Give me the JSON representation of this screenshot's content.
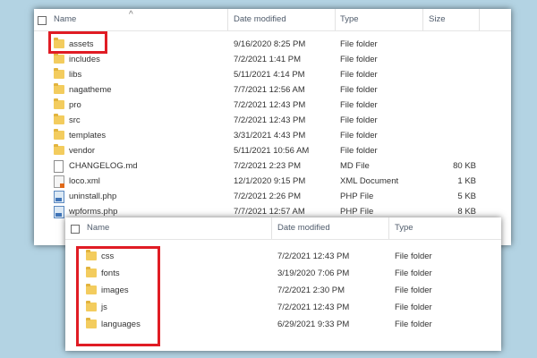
{
  "top_panel": {
    "columns": {
      "name": "Name",
      "date": "Date modified",
      "type": "Type",
      "size": "Size"
    },
    "rows": [
      {
        "name": "assets",
        "date": "9/16/2020 8:25 PM",
        "type": "File folder",
        "size": "",
        "icon": "folder-icon"
      },
      {
        "name": "includes",
        "date": "7/2/2021 1:41 PM",
        "type": "File folder",
        "size": "",
        "icon": "folder-icon"
      },
      {
        "name": "libs",
        "date": "5/11/2021 4:14 PM",
        "type": "File folder",
        "size": "",
        "icon": "folder-icon"
      },
      {
        "name": "nagatheme",
        "date": "7/7/2021 12:56 AM",
        "type": "File folder",
        "size": "",
        "icon": "folder-icon"
      },
      {
        "name": "pro",
        "date": "7/2/2021 12:43 PM",
        "type": "File folder",
        "size": "",
        "icon": "folder-icon"
      },
      {
        "name": "src",
        "date": "7/2/2021 12:43 PM",
        "type": "File folder",
        "size": "",
        "icon": "folder-icon"
      },
      {
        "name": "templates",
        "date": "3/31/2021 4:43 PM",
        "type": "File folder",
        "size": "",
        "icon": "folder-icon"
      },
      {
        "name": "vendor",
        "date": "5/11/2021 10:56 AM",
        "type": "File folder",
        "size": "",
        "icon": "folder-icon"
      },
      {
        "name": "CHANGELOG.md",
        "date": "7/2/2021 2:23 PM",
        "type": "MD File",
        "size": "80 KB",
        "icon": "document-icon"
      },
      {
        "name": "loco.xml",
        "date": "12/1/2020 9:15 PM",
        "type": "XML Document",
        "size": "1 KB",
        "icon": "xml-file-icon"
      },
      {
        "name": "uninstall.php",
        "date": "7/2/2021 2:26 PM",
        "type": "PHP File",
        "size": "5 KB",
        "icon": "php-file-icon"
      },
      {
        "name": "wpforms.php",
        "date": "7/7/2021 12:57 AM",
        "type": "PHP File",
        "size": "8 KB",
        "icon": "php-file-icon"
      }
    ]
  },
  "bottom_panel": {
    "columns": {
      "name": "Name",
      "date": "Date modified",
      "type": "Type"
    },
    "rows": [
      {
        "name": "css",
        "date": "7/2/2021 12:43 PM",
        "type": "File folder",
        "icon": "folder-icon"
      },
      {
        "name": "fonts",
        "date": "3/19/2020 7:06 PM",
        "type": "File folder",
        "icon": "folder-icon"
      },
      {
        "name": "images",
        "date": "7/2/2021 2:30 PM",
        "type": "File folder",
        "icon": "folder-icon"
      },
      {
        "name": "js",
        "date": "7/2/2021 12:43 PM",
        "type": "File folder",
        "icon": "folder-icon"
      },
      {
        "name": "languages",
        "date": "6/29/2021 9:33 PM",
        "type": "File folder",
        "icon": "folder-icon"
      }
    ]
  },
  "colors": {
    "highlight": "#e01c24",
    "folder": "#f3cc5e",
    "background": "#b3d3e3"
  }
}
